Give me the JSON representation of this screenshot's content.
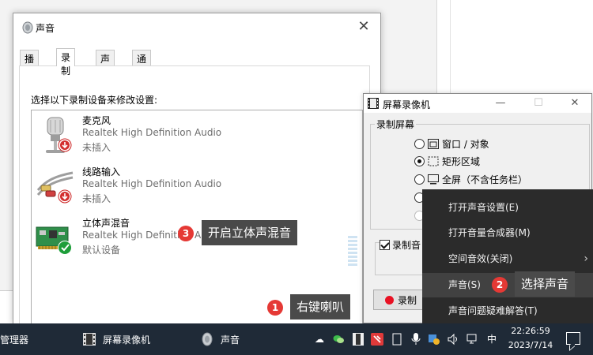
{
  "sound_dialog": {
    "title": "声音",
    "tabs": [
      "播放",
      "录制",
      "声音",
      "通信"
    ],
    "instruction": "选择以下录制设备来修改设置:",
    "devices": [
      {
        "name": "麦克风",
        "driver": "Realtek High Definition Audio",
        "status": "未插入"
      },
      {
        "name": "线路输入",
        "driver": "Realtek High Definition Audio",
        "status": "未插入"
      },
      {
        "name": "立体声混音",
        "driver": "Realtek High Definition Audio",
        "status": "默认设备"
      }
    ]
  },
  "recorder": {
    "title": "屏幕录像机",
    "group_label": "录制屏幕",
    "options": [
      "窗口 / 对象",
      "矩形区域",
      "全屏（不含任务栏）"
    ],
    "selected_option": "矩形区域",
    "audio_checkbox": "录制音",
    "record_button": "录制"
  },
  "context_menu": {
    "items": [
      "打开声音设置(E)",
      "打开音量合成器(M)",
      "空间音效(关闭)",
      "声音(S)",
      "声音问题疑难解答(T)"
    ],
    "highlighted": "声音(S)"
  },
  "annotations": {
    "step1": {
      "number": "1",
      "text": "右键喇叭"
    },
    "step2": {
      "number": "2",
      "text": "选择声音"
    },
    "step3": {
      "number": "3",
      "text": "开启立体声混音"
    }
  },
  "taskbar": {
    "apps": [
      "管理器",
      "屏幕录像机",
      "声音"
    ],
    "ime": "中",
    "time": "22:26:59",
    "date": "2023/7/14"
  },
  "colors": {
    "taskbar": "#1f2a37",
    "menu_bg": "#2b2b2b",
    "badge": "#e53935",
    "callout": "#4a4a4a"
  }
}
